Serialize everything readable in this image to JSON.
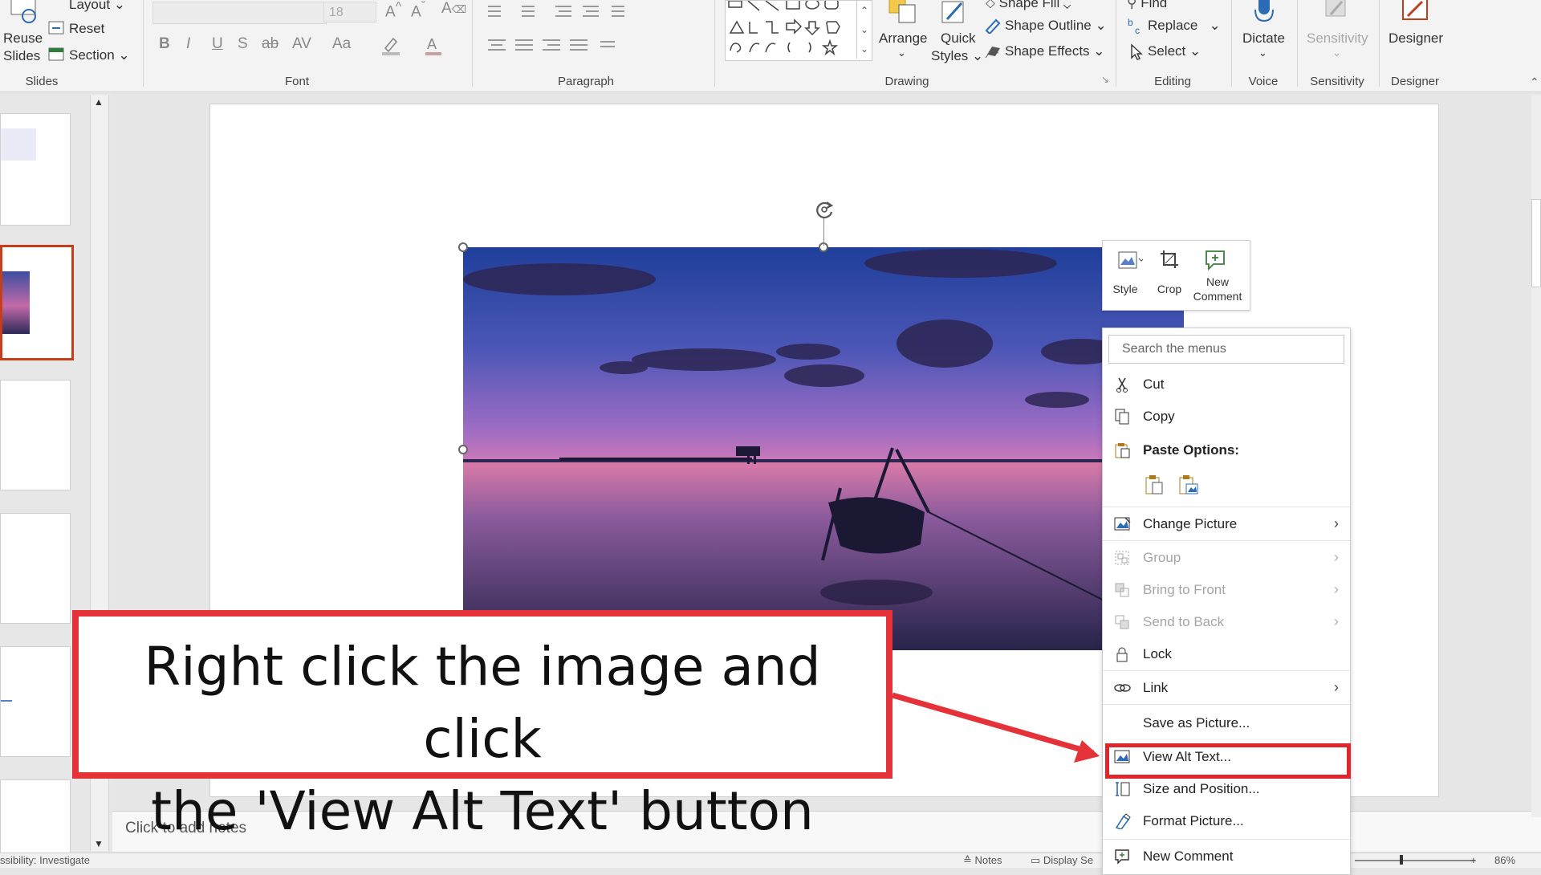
{
  "ribbon": {
    "slides_group": {
      "label": "Slides",
      "reuse_line1": "Reuse",
      "reuse_line2": "Slides",
      "layout": "Layout",
      "reset": "Reset",
      "section": "Section"
    },
    "font_group": {
      "label": "Font",
      "size_value": "18",
      "bold": "B",
      "italic": "I",
      "underline": "U",
      "shadow": "S",
      "strike": "ab",
      "spacing": "AV",
      "case": "Aa"
    },
    "paragraph_group": {
      "label": "Paragraph"
    },
    "drawing_group": {
      "label": "Drawing",
      "arrange": "Arrange",
      "quick_line1": "Quick",
      "quick_line2": "Styles",
      "shape_fill": "Shape Fill",
      "shape_outline": "Shape Outline",
      "shape_effects": "Shape Effects"
    },
    "editing_group": {
      "label": "Editing",
      "find": "Find",
      "replace": "Replace",
      "select": "Select"
    },
    "voice_group": {
      "label": "Voice",
      "dictate": "Dictate"
    },
    "sensitivity_group": {
      "label": "Sensitivity",
      "sensitivity": "Sensitivity"
    },
    "designer_group": {
      "label": "Designer",
      "designer": "Designer"
    }
  },
  "mini_toolbar": {
    "style": "Style",
    "crop": "Crop",
    "new_comment_line1": "New",
    "new_comment_line2": "Comment"
  },
  "context_menu": {
    "search_placeholder": "Search the menus",
    "cut": "Cut",
    "copy": "Copy",
    "paste_options": "Paste Options:",
    "change_picture": "Change Picture",
    "group": "Group",
    "bring_to_front": "Bring to Front",
    "send_to_back": "Send to Back",
    "lock": "Lock",
    "link": "Link",
    "save_as_picture": "Save as Picture...",
    "view_alt_text": "View Alt Text...",
    "size_and_position": "Size and Position...",
    "format_picture": "Format Picture...",
    "new_comment": "New Comment"
  },
  "notes_placeholder": "Click to add notes",
  "status_bar": {
    "accessibility": "ssibility: Investigate",
    "notes": "Notes",
    "display": "Display Se",
    "zoom": "86%"
  },
  "callout": {
    "line1": "Right click the image and click",
    "line2": "the 'View Alt Text' button"
  },
  "colors": {
    "highlight_red": "#e1252d",
    "callout_red": "#e53238",
    "selected_thumb_border": "#c43e1c"
  }
}
